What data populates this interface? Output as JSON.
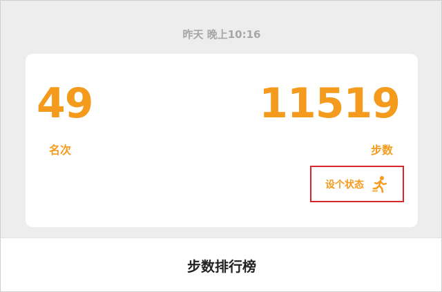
{
  "header": {
    "timestamp": "昨天 晚上10:16"
  },
  "card": {
    "rank_value": "49",
    "rank_label": "名次",
    "steps_value": "11519",
    "steps_label": "步数",
    "status_button_label": "设个状态",
    "status_icon": "runner-icon"
  },
  "footer": {
    "title": "步数排行榜"
  },
  "colors": {
    "accent": "#f49a1c",
    "highlight_border": "#d9242b",
    "background": "#ededed"
  }
}
